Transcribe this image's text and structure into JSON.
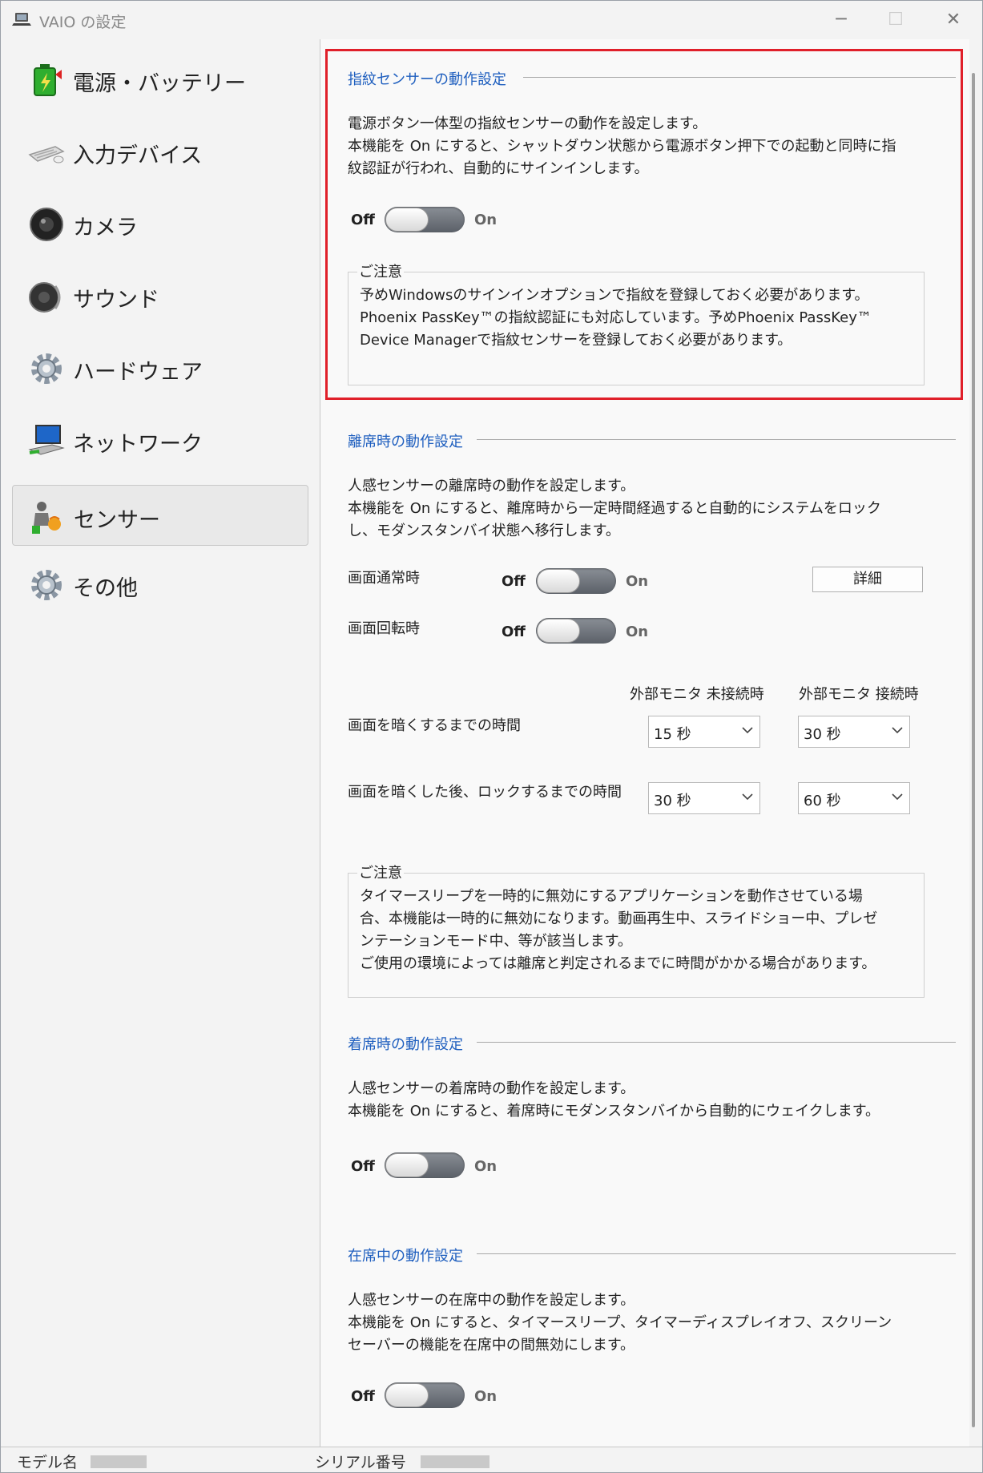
{
  "window": {
    "title": "VAIO の設定",
    "minimize_symbol": "─",
    "maximize_symbol": "☐",
    "close_symbol": "✕"
  },
  "sidebar": {
    "items": [
      {
        "label": "電源・バッテリー",
        "icon": "battery-icon"
      },
      {
        "label": "入力デバイス",
        "icon": "keyboard-icon"
      },
      {
        "label": "カメラ",
        "icon": "camera-icon"
      },
      {
        "label": "サウンド",
        "icon": "speaker-icon"
      },
      {
        "label": "ハードウェア",
        "icon": "gear-icon"
      },
      {
        "label": "ネットワーク",
        "icon": "network-icon"
      },
      {
        "label": "センサー",
        "icon": "sensor-icon",
        "selected": true
      },
      {
        "label": "その他",
        "icon": "gear-icon"
      }
    ]
  },
  "fingerprint": {
    "title": "指紋センサーの動作設定",
    "desc1": "電源ボタン一体型の指紋センサーの動作を設定します。",
    "desc2": "本機能を On にすると、シャットダウン状態から電源ボタン押下での起動と同時に指",
    "desc3": "紋認証が行われ、自動的にサインインします。",
    "off": "Off",
    "on": "On",
    "notice_label": "ご注意",
    "notice1": "予めWindowsのサインインオプションで指紋を登録しておく必要があります。",
    "notice2": "Phoenix PassKey™の指紋認証にも対応しています。予めPhoenix PassKey™",
    "notice3": "Device Managerで指紋センサーを登録しておく必要があります。"
  },
  "leaving": {
    "title": "離席時の動作設定",
    "desc1": "人感センサーの離席時の動作を設定します。",
    "desc2": "本機能を On にすると、離席時から一定時間経過すると自動的にシステムをロック",
    "desc3": "し、モダンスタンバイ状態へ移行します。",
    "normal_label": "画面通常時",
    "rotate_label": "画面回転時",
    "off": "Off",
    "on": "On",
    "detail_button": "詳細",
    "col_disconnected": "外部モニタ 未接続時",
    "col_connected": "外部モニタ 接続時",
    "dim_label": "画面を暗くするまでの時間",
    "lock_label": "画面を暗くした後、ロックするまでの時間",
    "dim_disconnected": "15 秒",
    "dim_connected": "30 秒",
    "lock_disconnected": "30 秒",
    "lock_connected": "60 秒",
    "notice_label": "ご注意",
    "notice1": "タイマースリープを一時的に無効にするアプリケーションを動作させている場",
    "notice2": "合、本機能は一時的に無効になります。動画再生中、スライドショー中、プレゼ",
    "notice3": "ンテーションモード中、等が該当します。",
    "notice4": "ご使用の環境によっては離席と判定されるまでに時間がかかる場合があります。"
  },
  "seated": {
    "title": "着席時の動作設定",
    "desc1": "人感センサーの着席時の動作を設定します。",
    "desc2": "本機能を On にすると、着席時にモダンスタンバイから自動的にウェイクします。",
    "off": "Off",
    "on": "On"
  },
  "present": {
    "title": "在席中の動作設定",
    "desc1": "人感センサーの在席中の動作を設定します。",
    "desc2": "本機能を On にすると、タイマースリープ、タイマーディスプレイオフ、スクリーン",
    "desc3": "セーバーの機能を在席中の間無効にします。",
    "off": "Off",
    "on": "On"
  },
  "status": {
    "model_label": "モデル名",
    "serial_label": "シリアル番号"
  }
}
